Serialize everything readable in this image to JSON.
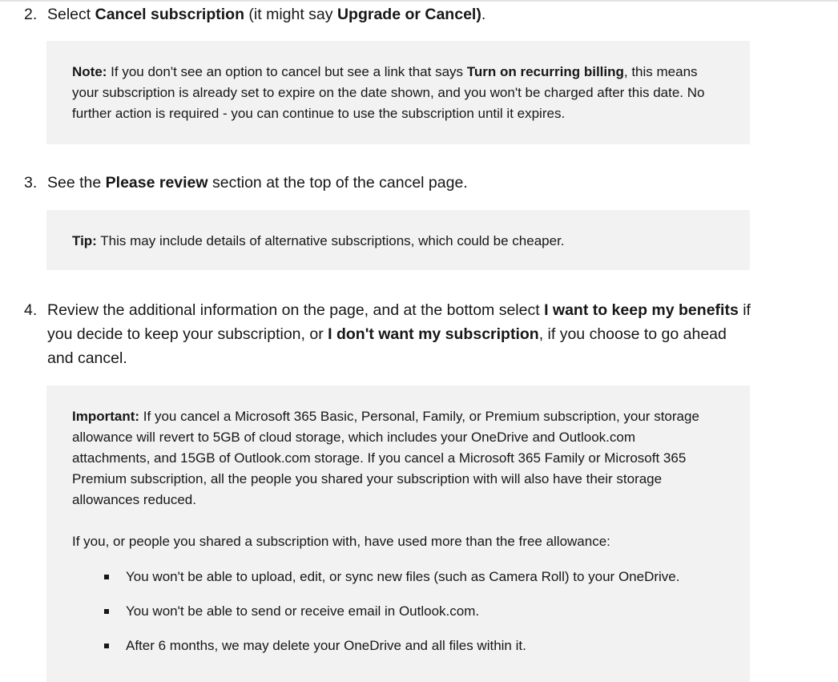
{
  "steps": [
    {
      "num": "2.",
      "segments": [
        {
          "t": "Select "
        },
        {
          "t": "Cancel subscription",
          "b": true
        },
        {
          "t": " (it might say "
        },
        {
          "t": "Upgrade or Cancel)",
          "b": true
        },
        {
          "t": "."
        }
      ]
    },
    {
      "num": "3.",
      "segments": [
        {
          "t": "See the "
        },
        {
          "t": "Please review",
          "b": true
        },
        {
          "t": " section at the top of the cancel page."
        }
      ]
    },
    {
      "num": "4.",
      "segments": [
        {
          "t": "Review the additional information on the page, and at the bottom select "
        },
        {
          "t": "I want to keep my benefits",
          "b": true
        },
        {
          "t": " if you decide to keep your subscription, or "
        },
        {
          "t": "I don't want my subscription",
          "b": true
        },
        {
          "t": ", if you choose to go ahead and cancel."
        }
      ]
    }
  ],
  "notes": {
    "note": [
      {
        "t": "Note:",
        "b": true
      },
      {
        "t": " If you don't see an option to cancel but see a link that says "
      },
      {
        "t": "Turn on recurring billing",
        "b": true
      },
      {
        "t": ", this means your subscription is already set to expire on the date shown, and you won't be charged after this date. No further action is required - you can continue to use the subscription until it expires."
      }
    ],
    "tip": [
      {
        "t": "Tip:",
        "b": true
      },
      {
        "t": " This may include details of alternative subscriptions, which could be cheaper."
      }
    ],
    "important": [
      {
        "t": "Important:",
        "b": true
      },
      {
        "t": " If you cancel a Microsoft 365 Basic, Personal, Family, or Premium subscription, your storage allowance will revert to 5GB of cloud storage, which includes your OneDrive and Outlook.com attachments, and 15GB of Outlook.com storage. If you cancel a Microsoft 365 Family or Microsoft 365 Premium subscription, all the people you shared your subscription with will also have their storage allowances reduced."
      }
    ],
    "important_followup": "If you, or people you shared a subscription with, have used more than the free allowance:",
    "bullets": [
      "You won't be able to upload, edit, or sync new files (such as Camera Roll) to your OneDrive.",
      "You won't be able to send or receive email in Outlook.com.",
      "After 6 months, we may delete your OneDrive and all files within it."
    ]
  }
}
